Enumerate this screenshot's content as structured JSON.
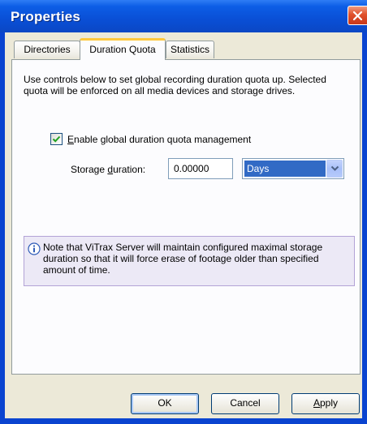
{
  "window": {
    "title": "Properties"
  },
  "tabs": [
    {
      "label": "Directories",
      "active": false
    },
    {
      "label": "Duration Quota",
      "active": true
    },
    {
      "label": "Statistics",
      "active": false
    }
  ],
  "panel": {
    "description": "Use controls below to set global recording duration quota up. Selected quota will be enforced on all media devices and storage drives.",
    "checkbox": {
      "label_prefix": "",
      "label_mnemonic": "E",
      "label_rest": "nable global duration quota management",
      "checked": true
    },
    "storage": {
      "label_prefix": "Storage ",
      "label_mnemonic": "d",
      "label_rest": "uration:",
      "value": "0.00000",
      "unit": "Days"
    },
    "note": {
      "text": "Note that ViTrax Server will maintain configured maximal storage duration so that it will force erase of footage older than specified amount of time."
    }
  },
  "buttons": {
    "ok": "OK",
    "cancel": "Cancel",
    "apply_mnemonic": "A",
    "apply_rest": "pply"
  },
  "icons": {
    "close": "close-icon",
    "check": "check-icon",
    "dropdown": "chevron-down-icon",
    "info": "info-icon"
  },
  "colors": {
    "title_bar": "#0a4fd6",
    "close_button": "#e0502b",
    "selection": "#316ac5",
    "note_background": "#ece9f6",
    "active_tab_accent": "#ffc83c"
  }
}
